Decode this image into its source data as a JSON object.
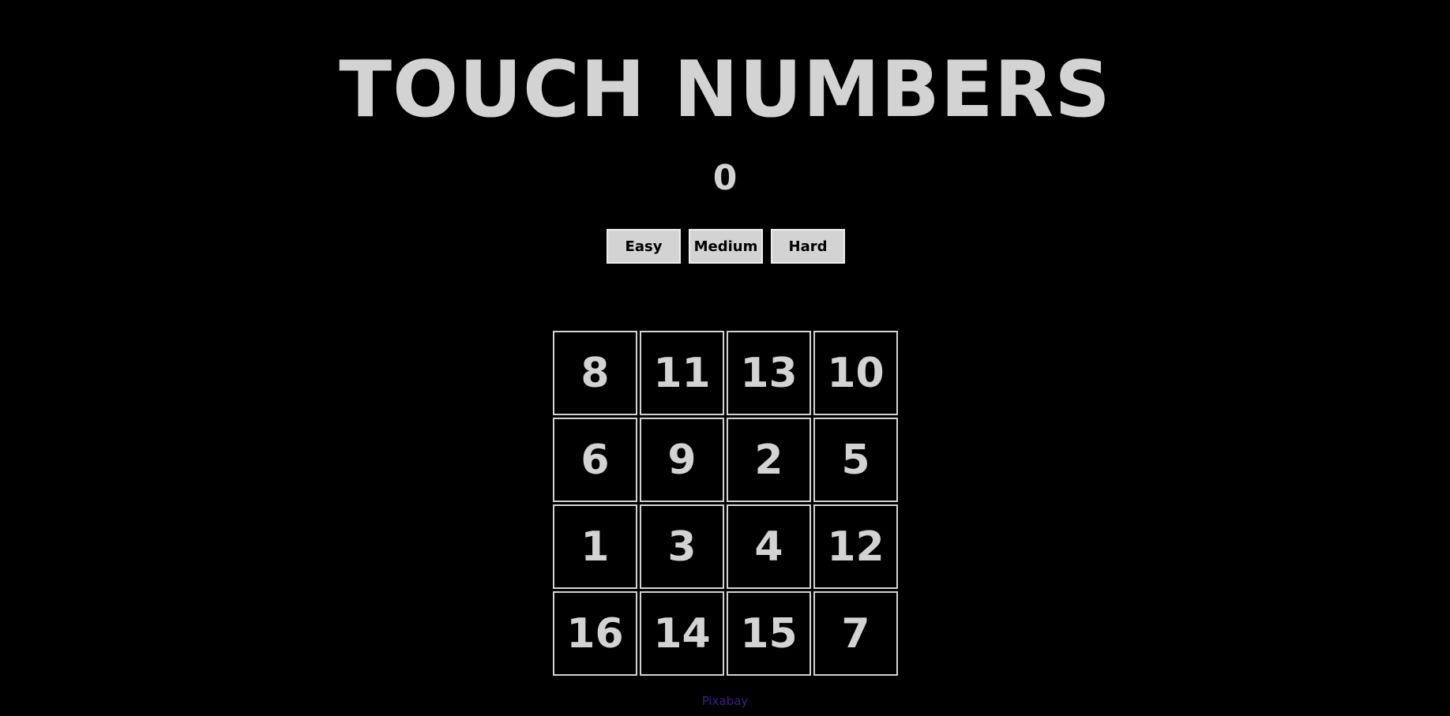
{
  "game": {
    "title": "TOUCH NUMBERS",
    "score": "0"
  },
  "levels": [
    {
      "label": "Easy"
    },
    {
      "label": "Medium"
    },
    {
      "label": "Hard"
    }
  ],
  "board": {
    "tiles": [
      "8",
      "11",
      "13",
      "10",
      "6",
      "9",
      "2",
      "5",
      "1",
      "3",
      "4",
      "12",
      "16",
      "14",
      "15",
      "7"
    ]
  },
  "footer": {
    "credit": "Pixabay",
    "credit_color": "#3b1f8a"
  },
  "colors": {
    "background": "#000000",
    "foreground": "#d3d3d3"
  }
}
